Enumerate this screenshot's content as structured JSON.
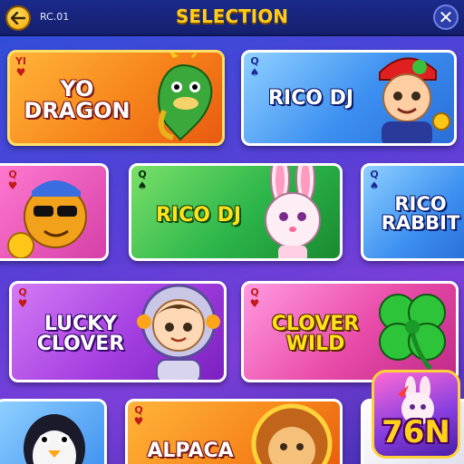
{
  "header": {
    "code": "RC.01",
    "title": "SELECTION",
    "close_symbol": "✕"
  },
  "cards": {
    "yo_dragon": {
      "rank": "YI",
      "suit": "♥",
      "line1": "YO",
      "line2": "DRAGON"
    },
    "rico_dj_top": {
      "rank": "Q",
      "suit": "♠",
      "label": "RICO DJ"
    },
    "monkey": {
      "rank": "Q",
      "suit": "♥"
    },
    "rico_dj_green": {
      "rank": "Q",
      "suit": "♠",
      "label": "RICO DJ"
    },
    "rico_rabbit": {
      "rank": "Q",
      "suit": "♠",
      "line1": "RICO",
      "line2": "RABBIT"
    },
    "lucky_clover": {
      "rank": "Q",
      "suit": "♥",
      "line1": "LUCKY",
      "line2": "CLOVER"
    },
    "clover_wild": {
      "rank": "Q",
      "suit": "♥",
      "line1": "CLOVER",
      "line2": "WILD"
    },
    "alpaca": {
      "rank": "Q",
      "suit": "♥",
      "label": "ALPACA"
    }
  },
  "logo": {
    "text": "76N"
  },
  "colors": {
    "title": "#ffcc1a",
    "orange_card": "#f7891c",
    "blue_card": "#3c8ff0",
    "green_card": "#2cb54a",
    "purple_card": "#a43fe0",
    "pink_card": "#e84aa8"
  }
}
